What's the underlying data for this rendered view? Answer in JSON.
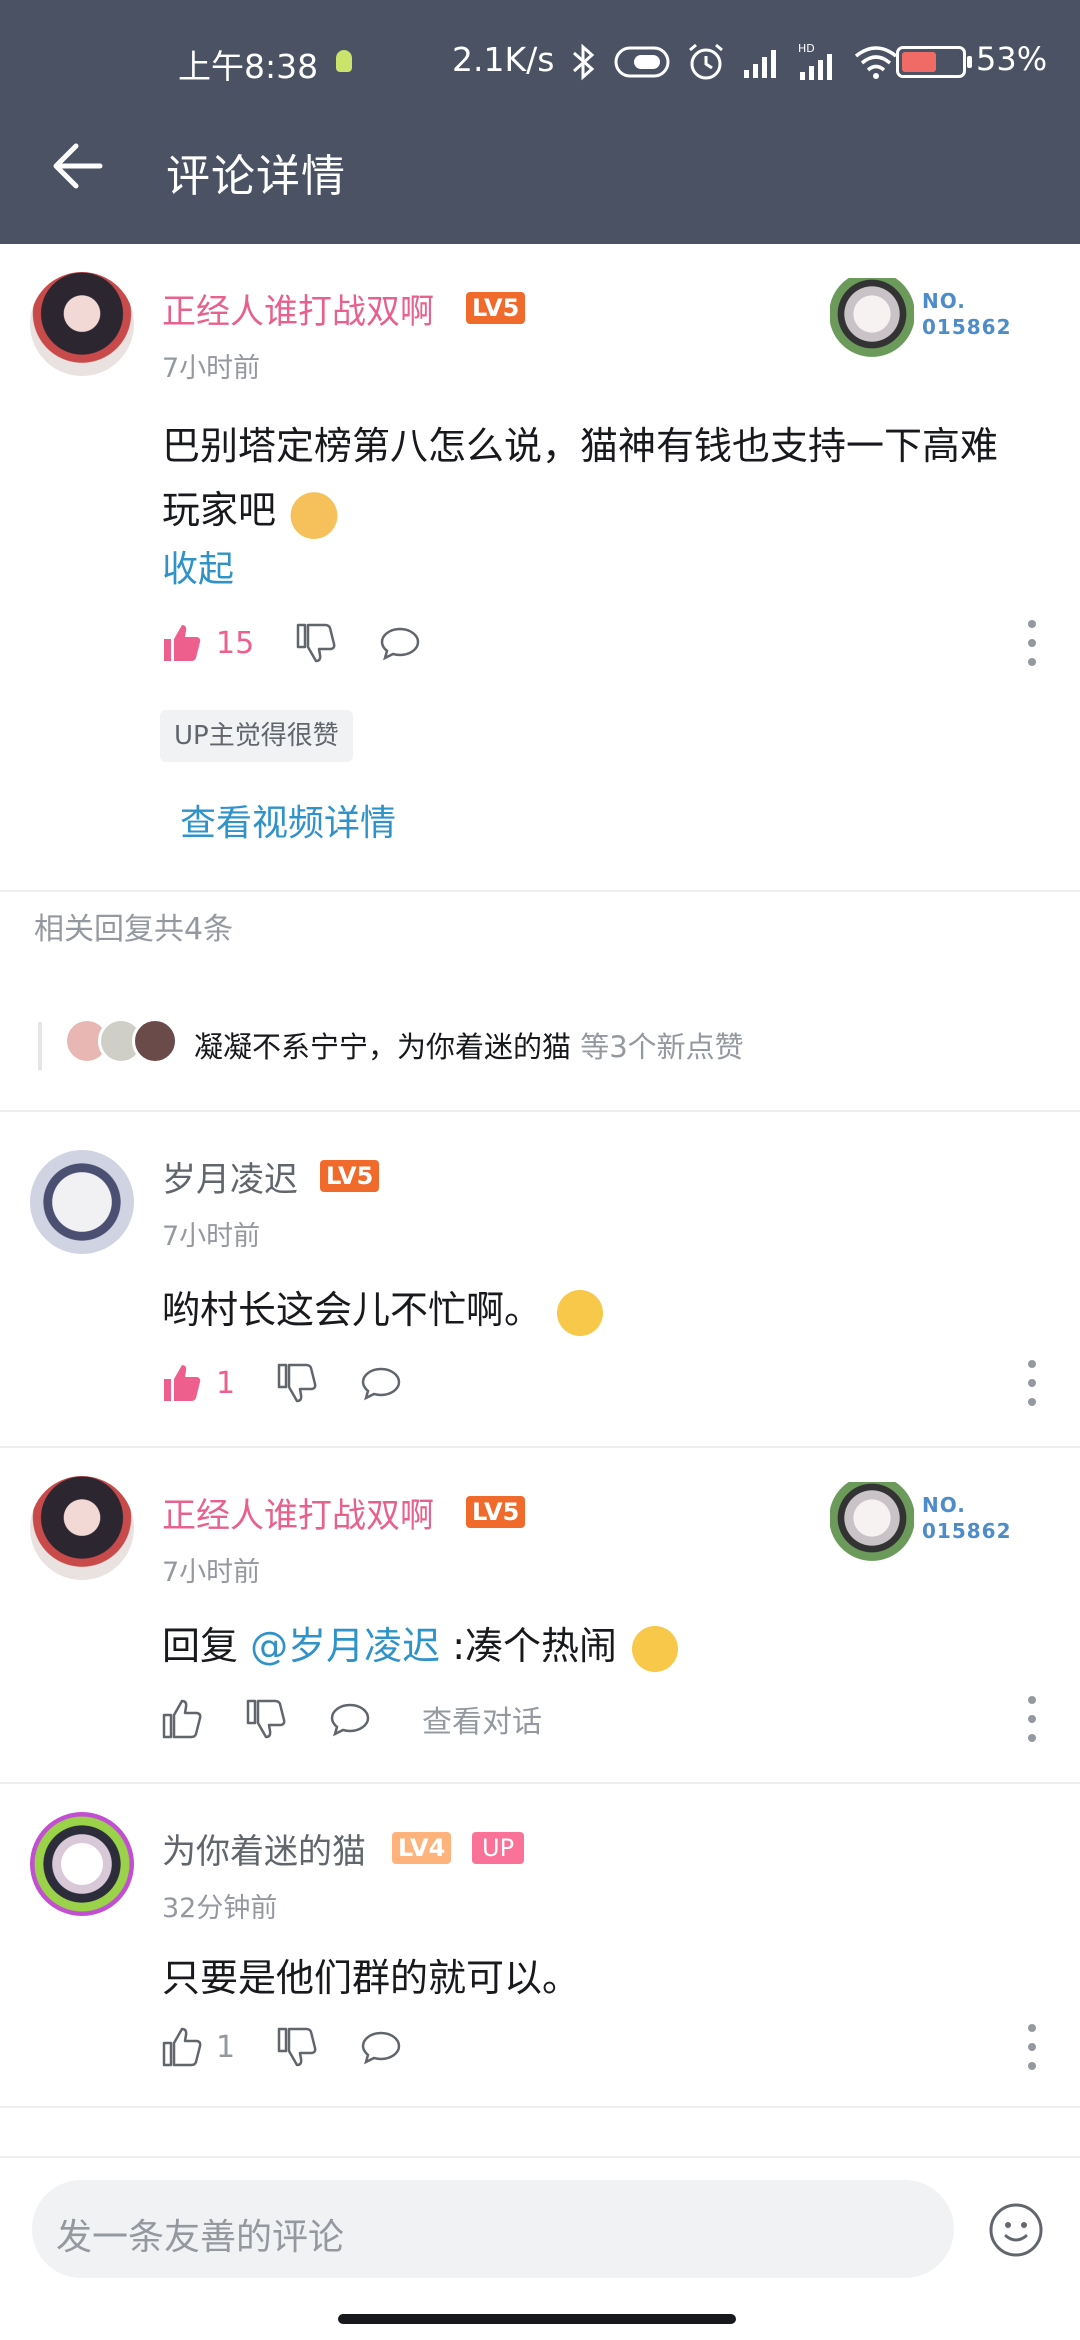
{
  "status": {
    "time": "上午8:38",
    "network_speed": "2.1K/s",
    "battery": "53%",
    "battery_level": 0.53,
    "icons": [
      "bluetooth-icon",
      "vibrate-icon",
      "alarm-icon",
      "signal-icon",
      "hd-signal-icon",
      "wifi-icon",
      "battery-icon"
    ]
  },
  "header": {
    "title": "评论详情"
  },
  "main_comment": {
    "username": "正经人谁打战双啊",
    "level": "LV5",
    "badge_no": "NO.\n015862",
    "time": "7小时前",
    "text": "巴别塔定榜第八怎么说，猫神有钱也支持一下高难玩家吧",
    "fold": "收起",
    "likes": "15",
    "up_tip": "UP主觉得很赞",
    "video_link": "查看视频详情"
  },
  "related": {
    "label": "相关回复共4条",
    "likers": "凝凝不系宁宁，为你着迷的猫",
    "likers_suffix": " 等3个新点赞"
  },
  "replies": [
    {
      "username": "岁月凌迟",
      "level": "LV5",
      "time": "7小时前",
      "text": "哟村长这会儿不忙啊。",
      "likes": "1"
    },
    {
      "username": "正经人谁打战双啊",
      "level": "LV5",
      "badge_no": "NO.\n015862",
      "time": "7小时前",
      "reply_prefix": "回复 ",
      "mention": "@岁月凌迟",
      "text": " :凑个热闹",
      "view_conversation": "查看对话"
    },
    {
      "username": "为你着迷的猫",
      "level": "LV4",
      "up_tag": "UP",
      "time": "32分钟前",
      "text": "只要是他们群的就可以。",
      "likes": "1"
    }
  ],
  "input": {
    "placeholder": "发一条友善的评论"
  },
  "colors": {
    "header_bg": "#4a5263",
    "vip_name": "#e8618c",
    "link": "#2f92c8",
    "like_pink": "#ef5f8d",
    "lv5": "#f06a2c",
    "lv4": "#ffb37c"
  }
}
